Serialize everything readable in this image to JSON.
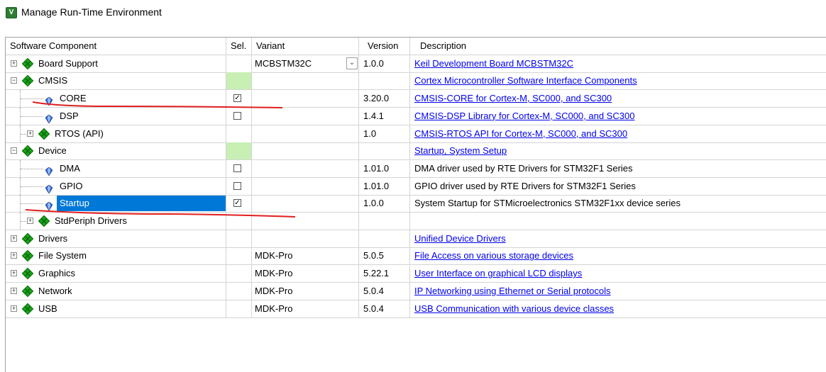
{
  "window": {
    "title": "Manage Run-Time Environment",
    "icon": "app-icon"
  },
  "columns": {
    "component": "Software Component",
    "sel": "Sel.",
    "variant": "Variant",
    "version": "Version",
    "description": "Description"
  },
  "rows": [
    {
      "label": "Board Support",
      "level": 0,
      "expander": "+",
      "icon": "pack-icon",
      "sel": "",
      "sel_green": false,
      "variant": "MCBSTM32C",
      "has_dropdown": true,
      "version": "1.0.0",
      "description": "Keil Development Board MCBSTM32C",
      "desc_link": true
    },
    {
      "label": "CMSIS",
      "level": 0,
      "expander": "−",
      "icon": "pack-icon",
      "sel": "",
      "sel_green": true,
      "variant": "",
      "version": "",
      "description": "Cortex Microcontroller Software Interface Components",
      "desc_link": true
    },
    {
      "label": "CORE",
      "level": 1,
      "expander": "",
      "icon": "gem-icon",
      "sel": "checked",
      "variant": "",
      "version": "3.20.0",
      "description": "CMSIS-CORE for Cortex-M, SC000, and SC300",
      "desc_link": true
    },
    {
      "label": "DSP",
      "level": 1,
      "expander": "",
      "icon": "gem-icon",
      "sel": "unchecked",
      "variant": "",
      "version": "1.4.1",
      "description": "CMSIS-DSP Library for Cortex-M, SC000, and SC300",
      "desc_link": true
    },
    {
      "label": "RTOS (API)",
      "level": 1,
      "expander": "+",
      "icon": "pack-icon",
      "sel": "",
      "variant": "",
      "version": "1.0",
      "description": "CMSIS-RTOS API for Cortex-M, SC000, and SC300",
      "desc_link": true
    },
    {
      "label": "Device",
      "level": 0,
      "expander": "−",
      "icon": "pack-icon",
      "sel": "",
      "sel_green": true,
      "variant": "",
      "version": "",
      "description": "Startup, System Setup",
      "desc_link": true
    },
    {
      "label": "DMA",
      "level": 1,
      "expander": "",
      "icon": "gem-icon",
      "sel": "unchecked",
      "variant": "",
      "version": "1.01.0",
      "description": "DMA driver used by RTE Drivers for STM32F1 Series",
      "desc_link": false
    },
    {
      "label": "GPIO",
      "level": 1,
      "expander": "",
      "icon": "gem-icon",
      "sel": "unchecked",
      "variant": "",
      "version": "1.01.0",
      "description": "GPIO driver used by RTE Drivers for STM32F1 Series",
      "desc_link": false
    },
    {
      "label": "Startup",
      "level": 1,
      "expander": "",
      "icon": "gem-icon",
      "sel": "checked",
      "variant": "",
      "version": "1.0.0",
      "description": "System Startup for STMicroelectronics STM32F1xx device series",
      "desc_link": false,
      "selected": true
    },
    {
      "label": "StdPeriph Drivers",
      "level": 1,
      "expander": "+",
      "icon": "pack-icon",
      "sel": "",
      "variant": "",
      "version": "",
      "description": "",
      "desc_link": false
    },
    {
      "label": "Drivers",
      "level": 0,
      "expander": "+",
      "icon": "pack-icon",
      "sel": "",
      "variant": "",
      "version": "",
      "description": "Unified Device Drivers",
      "desc_link": true
    },
    {
      "label": "File System",
      "level": 0,
      "expander": "+",
      "icon": "pack-icon",
      "sel": "",
      "variant": "MDK-Pro",
      "version": "5.0.5",
      "description": "File Access on various storage devices",
      "desc_link": true
    },
    {
      "label": "Graphics",
      "level": 0,
      "expander": "+",
      "icon": "pack-icon",
      "sel": "",
      "variant": "MDK-Pro",
      "version": "5.22.1",
      "description": "User Interface on graphical LCD displays",
      "desc_link": true
    },
    {
      "label": "Network",
      "level": 0,
      "expander": "+",
      "icon": "pack-icon",
      "sel": "",
      "variant": "MDK-Pro",
      "version": "5.0.4",
      "description": "IP Networking using Ethernet or Serial protocols",
      "desc_link": true
    },
    {
      "label": "USB",
      "level": 0,
      "expander": "+",
      "icon": "pack-icon",
      "sel": "",
      "variant": "MDK-Pro",
      "version": "5.0.4",
      "description": "USB Communication with various device classes",
      "desc_link": true
    }
  ],
  "colors": {
    "selection": "#0078d7",
    "sel_green": "#c8f0b4",
    "link": "#0000ee",
    "annotation": "#e02020"
  }
}
